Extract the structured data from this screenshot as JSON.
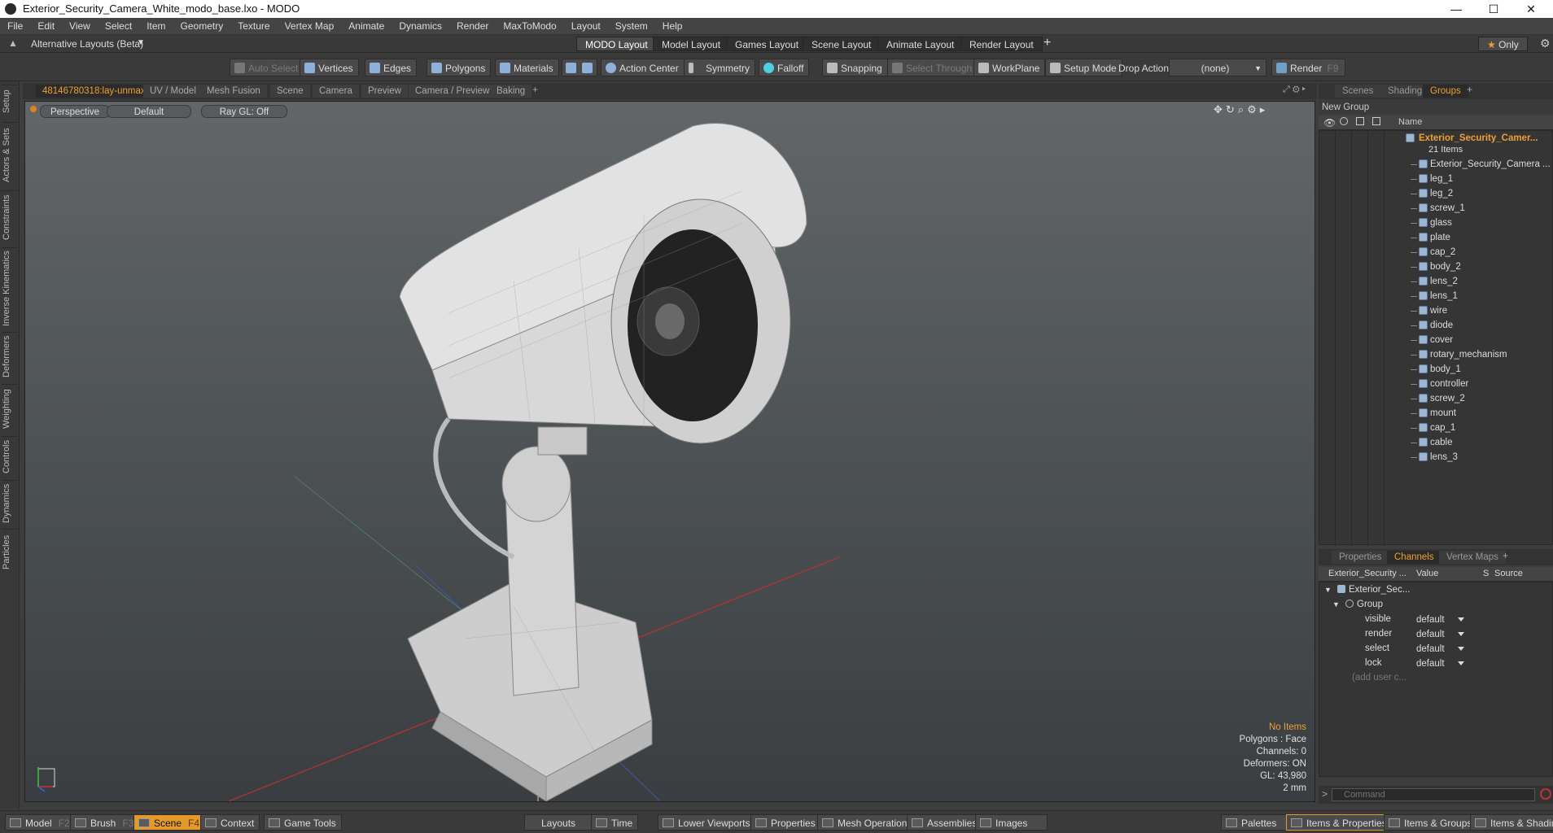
{
  "window": {
    "title": "Exterior_Security_Camera_White_modo_base.lxo - MODO",
    "controls": [
      "—",
      "☐",
      "✕"
    ]
  },
  "menu": [
    "File",
    "Edit",
    "View",
    "Select",
    "Item",
    "Geometry",
    "Texture",
    "Vertex Map",
    "Animate",
    "Dynamics",
    "Render",
    "MaxToModo",
    "Layout",
    "System",
    "Help"
  ],
  "layouts": {
    "selector": "Alternative Layouts (Beta)",
    "tabs": [
      "MODO Layout",
      "Model Layout",
      "Games Layout",
      "Scene Layout",
      "Animate Layout",
      "Render Layout"
    ],
    "active": "MODO Layout",
    "add": "+",
    "only": "Only"
  },
  "toolbar": {
    "auto_select": "Auto Select",
    "vertices": "Vertices",
    "edges": "Edges",
    "polygons": "Polygons",
    "materials": "Materials",
    "action_center": "Action Center",
    "symmetry": "Symmetry",
    "falloff": "Falloff",
    "snapping": "Snapping",
    "select_through": "Select Through",
    "workplane": "WorkPlane",
    "setup_mode": "Setup Mode",
    "drop_action": "Drop Action",
    "drop_value": "(none)",
    "render": "Render"
  },
  "left_tabs": [
    "Setup",
    "Actors & Sets",
    "Constraints",
    "Inverse Kinematics",
    "Deformers",
    "Weighting",
    "Controls",
    "Dynamics",
    "Particles"
  ],
  "viewport_tabs": [
    "48146780318:lay-unmax",
    "UV / Model",
    "Mesh Fusion",
    "Scene",
    "Camera",
    "Preview",
    "Camera / Preview",
    "Baking"
  ],
  "viewport_tabs_add": "+",
  "viewport": {
    "view": "Perspective",
    "shading": "Default",
    "raygl": "Ray GL: Off",
    "hud": {
      "no_items": "No Items",
      "polygons": "Polygons : Face",
      "channels": "Channels: 0",
      "deformers": "Deformers: ON",
      "gl": "GL: 43,980",
      "unit": "2 mm"
    }
  },
  "scene_tabs": [
    "Scenes",
    "Shading",
    "Groups"
  ],
  "scene_tabs_add": "+",
  "groups": {
    "new_group": "New Group",
    "col_name": "Name",
    "root": "Exterior_Security_Camer...",
    "root_count": "21 Items",
    "items": [
      "Exterior_Security_Camera ...",
      "leg_1",
      "leg_2",
      "screw_1",
      "glass",
      "plate",
      "cap_2",
      "body_2",
      "lens_2",
      "lens_1",
      "wire",
      "diode",
      "cover",
      "rotary_mechanism",
      "body_1",
      "controller",
      "screw_2",
      "mount",
      "cap_1",
      "cable",
      "lens_3"
    ]
  },
  "channels_tabs": [
    "Properties",
    "Channels",
    "Vertex Maps"
  ],
  "channels_tabs_add": "+",
  "channels": {
    "col_item": "Exterior_Security ...",
    "col_value": "Value",
    "col_s": "S",
    "col_source": "Source",
    "root": "Exterior_Sec...",
    "group": "Group",
    "rows": [
      {
        "name": "visible",
        "value": "default"
      },
      {
        "name": "render",
        "value": "default"
      },
      {
        "name": "select",
        "value": "default"
      },
      {
        "name": "lock",
        "value": "default"
      }
    ],
    "add_user": "(add user c..."
  },
  "command": {
    "placeholder": "Command"
  },
  "bottom": {
    "model": "Model",
    "model_key": "F2",
    "brush": "Brush",
    "brush_key": "F3",
    "scene": "Scene",
    "scene_key": "F4",
    "context": "Context",
    "game_tools": "Game Tools",
    "layouts": "Layouts",
    "time": "Time",
    "lower_viewports": "Lower Viewports",
    "properties": "Properties",
    "mesh_operations": "Mesh Operations",
    "assemblies": "Assemblies",
    "images": "Images",
    "palettes": "Palettes",
    "items_properties": "Items & Properties",
    "items_groups": "Items & Groups",
    "items_shading": "Items & Shading"
  },
  "colors": {
    "accent": "#f0a030",
    "active_tab": "#e39a2a"
  }
}
